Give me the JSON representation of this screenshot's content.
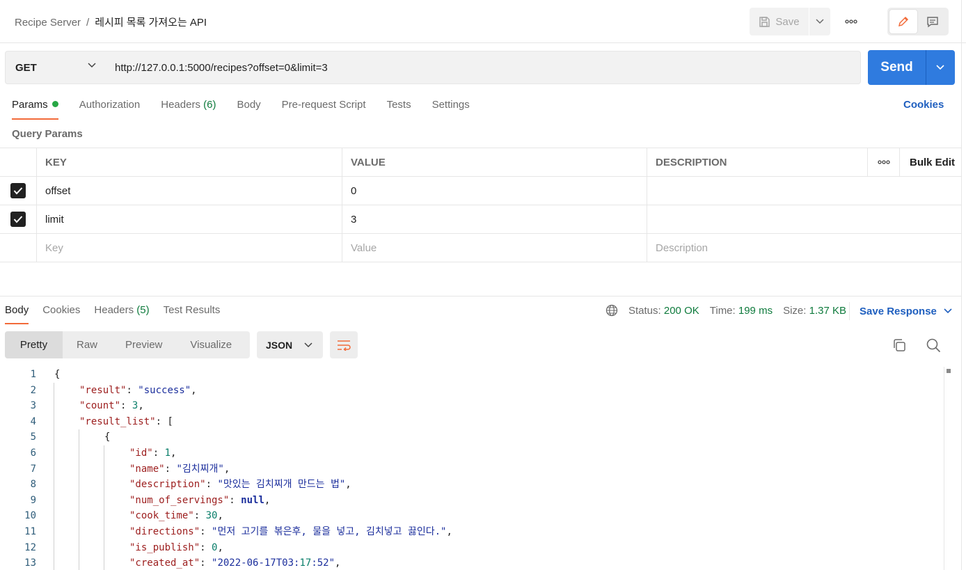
{
  "breadcrumb": {
    "parent": "Recipe Server",
    "separator": "/",
    "current": "레시피 목록 가져오는 API"
  },
  "header": {
    "save_label": "Save"
  },
  "request": {
    "method": "GET",
    "url": "http://127.0.0.1:5000/recipes?offset=0&limit=3",
    "send_label": "Send"
  },
  "req_tabs": {
    "params": "Params",
    "authorization": "Authorization",
    "headers": "Headers",
    "headers_count": "(6)",
    "body": "Body",
    "prerequest": "Pre-request Script",
    "tests": "Tests",
    "settings": "Settings",
    "cookies": "Cookies"
  },
  "query_params": {
    "title": "Query Params",
    "columns": {
      "key": "KEY",
      "value": "VALUE",
      "description": "DESCRIPTION",
      "bulk_edit": "Bulk Edit"
    },
    "rows": [
      {
        "checked": true,
        "key": "offset",
        "value": "0",
        "description": ""
      },
      {
        "checked": true,
        "key": "limit",
        "value": "3",
        "description": ""
      }
    ],
    "placeholders": {
      "key": "Key",
      "value": "Value",
      "description": "Description"
    }
  },
  "response": {
    "tabs": {
      "body": "Body",
      "cookies": "Cookies",
      "headers": "Headers",
      "headers_count": "(5)",
      "test_results": "Test Results"
    },
    "status_label": "Status:",
    "status_value": "200 OK",
    "time_label": "Time:",
    "time_value": "199 ms",
    "size_label": "Size:",
    "size_value": "1.37 KB",
    "save_response": "Save Response",
    "views": {
      "pretty": "Pretty",
      "raw": "Raw",
      "preview": "Preview",
      "visualize": "Visualize"
    },
    "format": "JSON"
  },
  "code_lines": [
    {
      "n": "1",
      "text": "{"
    },
    {
      "n": "2",
      "text": "\"result\": \"success\","
    },
    {
      "n": "3",
      "text": "\"count\": 3,"
    },
    {
      "n": "4",
      "text": "\"result_list\": ["
    },
    {
      "n": "5",
      "text": "{"
    },
    {
      "n": "6",
      "text": "\"id\": 1,"
    },
    {
      "n": "7",
      "text": "\"name\": \"김치찌개\","
    },
    {
      "n": "8",
      "text": "\"description\": \"맛있는 김치찌개 만드는 법\","
    },
    {
      "n": "9",
      "text": "\"num_of_servings\": null,"
    },
    {
      "n": "10",
      "text": "\"cook_time\": 30,"
    },
    {
      "n": "11",
      "text": "\"directions\": \"먼저 고기를 볶은후, 물을 넣고, 김치넣고 끓인다.\","
    },
    {
      "n": "12",
      "text": "\"is_publish\": 0,"
    },
    {
      "n": "13",
      "text": "\"created_at\": \"2022-06-17T03:17:52\","
    }
  ],
  "colors": {
    "accent": "#f26b3a",
    "send": "#2f7bdf",
    "link": "#1f5fbf",
    "success": "#0f7b3d"
  }
}
